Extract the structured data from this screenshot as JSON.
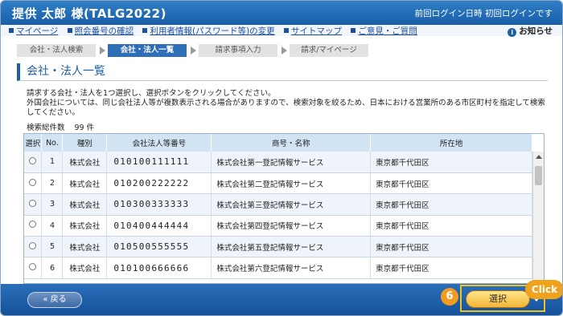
{
  "header": {
    "user": "提供 太郎 様(TALG2022)",
    "login_info": "前回ログイン日時 初回ログインです"
  },
  "nav": {
    "links": [
      "マイページ",
      "照会番号の確認",
      "利用者情報(パスワード等)の変更",
      "サイトマップ",
      "ご意見・ご質問"
    ],
    "notice": "お知らせ"
  },
  "steps": [
    "会社・法人検索",
    "会社・法人一覧",
    "請求事項入力",
    "請求/マイページ"
  ],
  "active_step": 1,
  "title": "会社・法人一覧",
  "instructions": [
    "請求する会社・法人を1つ選択し、選択ボタンをクリックしてください。",
    "外国会社については、同じ会社法人等が複数表示される場合がありますので、検索対象を絞るため、日本における営業所のある市区町村を指定して検索してください。"
  ],
  "result_count": {
    "label": "検索総件数",
    "value": "99 件"
  },
  "table": {
    "headers": [
      "選択",
      "No.",
      "種別",
      "会社法人等番号",
      "商号・名称",
      "所在地"
    ],
    "rows": [
      {
        "no": "1",
        "kind": "株式会社",
        "number": "010100111111",
        "name": "株式会社第一登記情報サービス",
        "address": "東京都千代田区"
      },
      {
        "no": "2",
        "kind": "株式会社",
        "number": "010200222222",
        "name": "株式会社第二登記情報サービス",
        "address": "東京都千代田区"
      },
      {
        "no": "3",
        "kind": "株式会社",
        "number": "010300333333",
        "name": "株式会社第三登記情報サービス",
        "address": "東京都千代田区"
      },
      {
        "no": "4",
        "kind": "株式会社",
        "number": "010400444444",
        "name": "株式会社第四登記情報サービス",
        "address": "東京都千代田区"
      },
      {
        "no": "5",
        "kind": "株式会社",
        "number": "010500555555",
        "name": "株式会社第五登記情報サービス",
        "address": "東京都千代田区"
      },
      {
        "no": "6",
        "kind": "株式会社",
        "number": "010100666666",
        "name": "株式会社第六登記情報サービス",
        "address": "東京都千代田区"
      }
    ]
  },
  "footer": {
    "back_label": "« 戻る",
    "select_label": "選択",
    "step_number": "6",
    "click_label": "Click"
  },
  "colors": {
    "header_blue": "#1a5fa8",
    "table_header": "#d2e3f3",
    "highlight": "#f2c21b",
    "select_button": "#f2b535",
    "callout_orange": "#f29b1e"
  }
}
